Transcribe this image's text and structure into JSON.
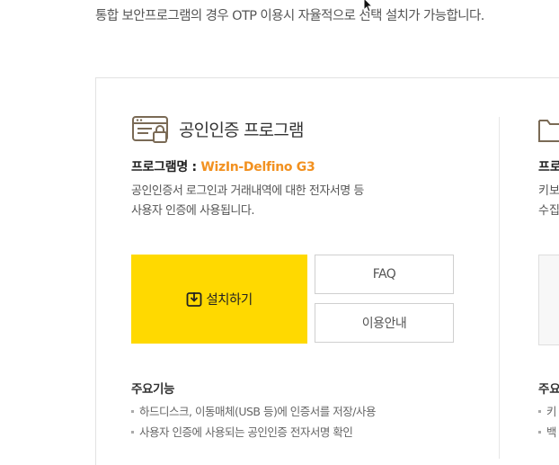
{
  "notice": "통합 보안프로그램의 경우 OTP 이용시 자율적으로 선택 설치가 가능합니다.",
  "card1": {
    "icon": "browser-lock-icon",
    "title": "공인인증 프로그램",
    "program_label": "프로그램명 : ",
    "program_name": "WizIn-Delfino G3",
    "desc_lines": [
      "공인인증서 로그인과 거래내역에 대한 전자서명 등",
      "사용자 인증에 사용됩니다."
    ],
    "install_label": "설치하기",
    "install_icon": "download-box-icon",
    "faq_label": "FAQ",
    "guide_label": "이용안내",
    "features_title": "주요기능",
    "features": [
      "하드디스크, 이동매체(USB 등)에 인증서를 저장/사용",
      "사용자 인증에 사용되는 공인인증 전자서명 확인"
    ]
  },
  "card2": {
    "icon": "folder-icon",
    "program_label": "프로",
    "desc_lines": [
      "키보",
      "수집"
    ],
    "features_title": "주요",
    "features": [
      "키",
      "백"
    ]
  },
  "colors": {
    "accent": "#ffd900",
    "program_name": "#f29120"
  }
}
